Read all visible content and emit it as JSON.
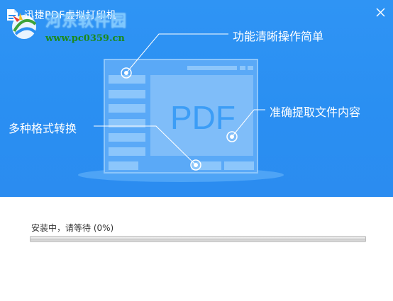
{
  "window": {
    "title": "迅捷PDF虚拟打印机",
    "close_icon": "close-icon"
  },
  "watermark": {
    "name": "河东软件园",
    "url": "www.pc0359.cn"
  },
  "banner": {
    "pdf_text": "PDF",
    "features": {
      "top": "功能清晰操作简单",
      "right": "准确提取文件内容",
      "left": "多种格式转换"
    }
  },
  "install": {
    "status": "安装中，请等待 (0%)",
    "progress": 0
  },
  "colors": {
    "banner": "#2a8ff2",
    "accent": "#3aa0f6",
    "text": "#333333"
  }
}
